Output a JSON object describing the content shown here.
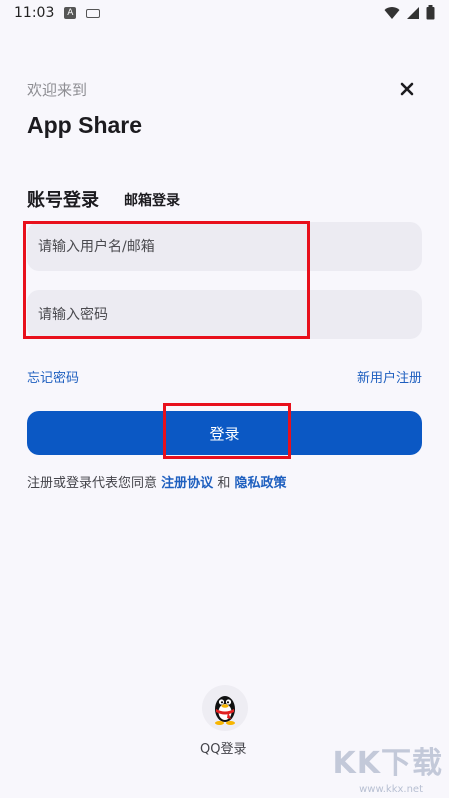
{
  "status_bar": {
    "time": "11:03",
    "icons": [
      "notification-a-icon",
      "keyboard-icon",
      "wifi-icon",
      "signal-icon",
      "battery-icon"
    ]
  },
  "header": {
    "welcome": "欢迎来到",
    "app_name": "App Share",
    "close_icon": "close-icon"
  },
  "tabs": {
    "account_login": "账号登录",
    "email_login": "邮箱登录"
  },
  "form": {
    "username_placeholder": "请输入用户名/邮箱",
    "username_value": "",
    "password_placeholder": "请输入密码",
    "password_value": ""
  },
  "links": {
    "forgot_password": "忘记密码",
    "new_user_register": "新用户注册"
  },
  "login_button": "登录",
  "agreement": {
    "prefix": "注册或登录代表您同意",
    "terms": "注册协议",
    "and": "和",
    "privacy": "隐私政策"
  },
  "social": {
    "qq_label": "QQ登录",
    "qq_icon": "qq-penguin-icon"
  },
  "watermark": {
    "text": "KK下载",
    "url": "www.kkx.net"
  },
  "colors": {
    "accent": "#0b58c4",
    "link": "#1e5fbf",
    "highlight": "#e8101c",
    "input_bg": "#ecebf2",
    "background": "#f8f7fc"
  }
}
